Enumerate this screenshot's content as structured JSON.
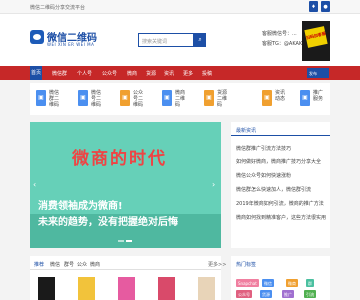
{
  "topbar": {
    "text": "微信二维码分享交流平台"
  },
  "header": {
    "logo_title": "微信二维码",
    "logo_sub": "WEI XIN ER WEI MA",
    "search_placeholder": "搜索关键词",
    "contact_line1": "客服微信号：...",
    "contact_line2": "客服TG：@AKAK569",
    "qr_label": "扫码加客服"
  },
  "nav": {
    "home": "首页",
    "items": [
      "微信群",
      "个人号",
      "公众号",
      "微商",
      "货源",
      "资讯",
      "更多",
      "投稿"
    ],
    "right": "发布"
  },
  "quick": [
    {
      "text": "微信群二维码",
      "color": "#4b8ff0"
    },
    {
      "text": "微信号二维码",
      "color": "#4b8ff0"
    },
    {
      "text": "公众号二维码",
      "color": "#f0a030"
    },
    {
      "text": "微商二维码",
      "color": "#4b8ff0"
    },
    {
      "text": "货源二维码",
      "color": "#f0a030"
    },
    {
      "text": "资讯动态",
      "color": "#f0a030"
    },
    {
      "text": "推广服务",
      "color": "#4b8ff0"
    }
  ],
  "banner": {
    "headline": "微商的时代",
    "line1": "消费领袖成为微商!",
    "line2": "未来的趋势，没有把握绝对后悔"
  },
  "news": {
    "title": "最新资讯",
    "items": [
      "微信群推广引流方法技巧",
      "如何做好微商，微商推广技巧分享大全",
      "微信公众号如何快速涨粉",
      "微信群怎么快速加人，微信群引流",
      "2019年微商如何引流，微商的推广方法",
      "微商如何找到精准客户，这些方法很实用"
    ]
  },
  "tabs": {
    "items": [
      "推荐",
      "微信",
      "群号",
      "公众",
      "微商"
    ],
    "more": "更多>>"
  },
  "thumbs": [
    {
      "color": "#1a1a1a"
    },
    {
      "color": "#f2c33b"
    },
    {
      "color": "#e65ba0"
    },
    {
      "color": "#d94a6a"
    },
    {
      "color": "#e8d4b8"
    }
  ],
  "tags": {
    "title": "热门标签",
    "items": [
      {
        "label": "Snapchat",
        "color": "#f07fa0"
      },
      {
        "label": "微信",
        "color": "#4b8ff0"
      },
      {
        "label": "微商",
        "color": "#f0a030"
      },
      {
        "label": "群",
        "color": "#4bc0a0"
      },
      {
        "label": "公众号",
        "color": "#e06080"
      },
      {
        "label": "货源",
        "color": "#4b8ff0"
      },
      {
        "label": "推广",
        "color": "#a070d0"
      },
      {
        "label": "引流",
        "color": "#50b050"
      }
    ]
  }
}
